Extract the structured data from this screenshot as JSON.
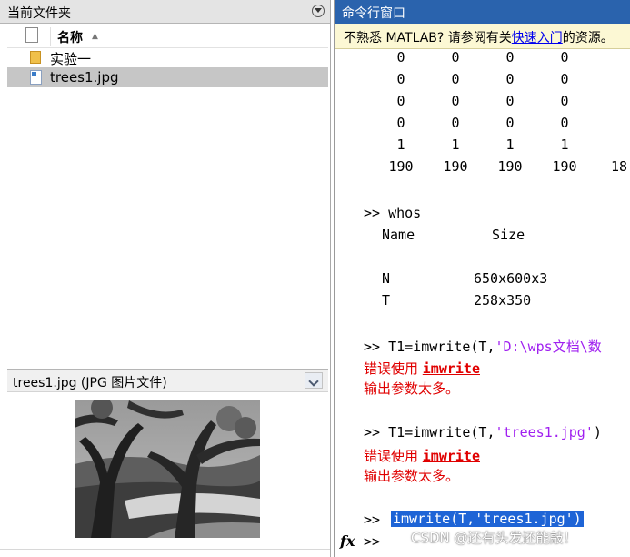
{
  "current_folder": {
    "title": "当前文件夹",
    "column_name": "名称",
    "sort_indicator": "▲",
    "items": [
      {
        "label": "实验一",
        "type": "folder"
      },
      {
        "label": "trees1.jpg",
        "type": "jpg-file",
        "selected": true
      }
    ]
  },
  "details": {
    "title": "trees1.jpg  (JPG 图片文件)"
  },
  "command_window": {
    "title": "命令行窗口",
    "notice": {
      "prefix": "不熟悉 MATLAB? 请参阅有关",
      "link": "快速入门",
      "suffix": "的资源。"
    },
    "matrix_rows": [
      [
        "0",
        "0",
        "0",
        "0"
      ],
      [
        "0",
        "0",
        "0",
        "0"
      ],
      [
        "0",
        "0",
        "0",
        "0"
      ],
      [
        "0",
        "0",
        "0",
        "0"
      ],
      [
        "1",
        "1",
        "1",
        "1"
      ],
      [
        "190",
        "190",
        "190",
        "190",
        "18"
      ]
    ],
    "whos": {
      "prompt": ">> ",
      "command": "whos",
      "header_name": "Name",
      "header_size": "Size",
      "rows": [
        {
          "name": "N",
          "size": "650x600x3"
        },
        {
          "name": "T",
          "size": "258x350"
        }
      ]
    },
    "attempt1": {
      "prompt": ">> ",
      "code_prefix": "T1=imwrite(T,",
      "code_string": "'D:\\wps文档\\数"
    },
    "error1": {
      "prefix": "错误使用 ",
      "function": "imwrite",
      "message": "输出参数太多。"
    },
    "attempt2": {
      "prompt": ">> ",
      "code_prefix": "T1=imwrite(T,",
      "code_string": "'trees1.jpg'",
      "code_suffix": ")"
    },
    "error2": {
      "prefix": "错误使用 ",
      "function": "imwrite",
      "message": "输出参数太多。"
    },
    "attempt3": {
      "prompt": ">> ",
      "command": "imwrite(T,'trees1.jpg')"
    },
    "current_prompt": ">>",
    "fx_label": "fx"
  },
  "watermark": "CSDN @还有头发还能敲！",
  "colors": {
    "titlebar": "#2a63ad",
    "error": "#e00000",
    "string": "#a020f0",
    "selection": "#1e64d6"
  }
}
